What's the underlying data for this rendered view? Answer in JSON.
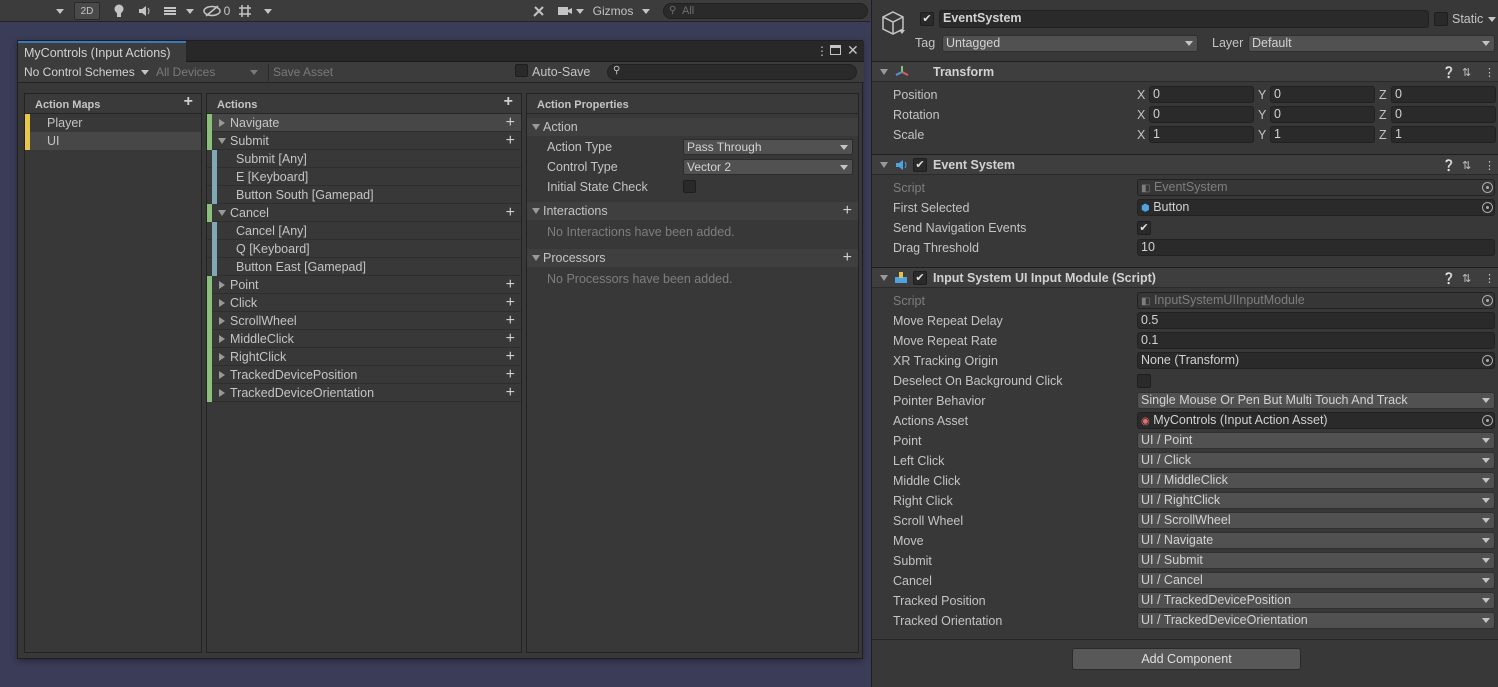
{
  "scene_toolbar": {
    "mode_2d": "2D",
    "hidden_count": "0",
    "gizmos_label": "Gizmos",
    "search_placeholder": "All"
  },
  "input_actions_window": {
    "tab_title": "MyControls (Input Actions)",
    "control_schemes": "No Control Schemes",
    "devices": "All Devices",
    "save_asset": "Save Asset",
    "auto_save": "Auto-Save",
    "action_maps_header": "Action Maps",
    "action_maps": [
      "Player",
      "UI"
    ],
    "actions_header": "Actions",
    "actions": [
      {
        "label": "Navigate",
        "kind": "action",
        "expanded": false
      },
      {
        "label": "Submit",
        "kind": "action",
        "expanded": true
      },
      {
        "label": "Submit [Any]",
        "kind": "binding"
      },
      {
        "label": "E [Keyboard]",
        "kind": "binding"
      },
      {
        "label": "Button South [Gamepad]",
        "kind": "binding"
      },
      {
        "label": "Cancel",
        "kind": "action",
        "expanded": true
      },
      {
        "label": "Cancel [Any]",
        "kind": "binding"
      },
      {
        "label": "Q [Keyboard]",
        "kind": "binding"
      },
      {
        "label": "Button East [Gamepad]",
        "kind": "binding"
      },
      {
        "label": "Point",
        "kind": "action",
        "expanded": false
      },
      {
        "label": "Click",
        "kind": "action",
        "expanded": false
      },
      {
        "label": "ScrollWheel",
        "kind": "action",
        "expanded": false
      },
      {
        "label": "MiddleClick",
        "kind": "action",
        "expanded": false
      },
      {
        "label": "RightClick",
        "kind": "action",
        "expanded": false
      },
      {
        "label": "TrackedDevicePosition",
        "kind": "action",
        "expanded": false
      },
      {
        "label": "TrackedDeviceOrientation",
        "kind": "action",
        "expanded": false
      }
    ],
    "properties_header": "Action Properties",
    "action_section": "Action",
    "action_type_label": "Action Type",
    "action_type_value": "Pass Through",
    "control_type_label": "Control Type",
    "control_type_value": "Vector 2",
    "initial_state_label": "Initial State Check",
    "interactions_section": "Interactions",
    "interactions_empty": "No Interactions have been added.",
    "processors_section": "Processors",
    "processors_empty": "No Processors have been added."
  },
  "inspector": {
    "object_name": "EventSystem",
    "static_label": "Static",
    "tag_label": "Tag",
    "tag_value": "Untagged",
    "layer_label": "Layer",
    "layer_value": "Default",
    "transform": {
      "title": "Transform",
      "position_label": "Position",
      "rotation_label": "Rotation",
      "scale_label": "Scale",
      "x": "X",
      "y": "Y",
      "z": "Z",
      "position": [
        "0",
        "0",
        "0"
      ],
      "rotation": [
        "0",
        "0",
        "0"
      ],
      "scale": [
        "1",
        "1",
        "1"
      ]
    },
    "event_system": {
      "title": "Event System",
      "script_label": "Script",
      "script_value": "EventSystem",
      "first_selected_label": "First Selected",
      "first_selected_value": "Button",
      "send_nav_label": "Send Navigation Events",
      "drag_threshold_label": "Drag Threshold",
      "drag_threshold_value": "10"
    },
    "input_module": {
      "title": "Input System UI Input Module (Script)",
      "script_label": "Script",
      "script_value": "InputSystemUIInputModule",
      "move_repeat_delay_label": "Move Repeat Delay",
      "move_repeat_delay_value": "0.5",
      "move_repeat_rate_label": "Move Repeat Rate",
      "move_repeat_rate_value": "0.1",
      "xr_origin_label": "XR Tracking Origin",
      "xr_origin_value": "None (Transform)",
      "deselect_label": "Deselect On Background Click",
      "pointer_behavior_label": "Pointer Behavior",
      "pointer_behavior_value": "Single Mouse Or Pen But Multi Touch And Track",
      "actions_asset_label": "Actions Asset",
      "actions_asset_value": "MyControls (Input Action Asset)",
      "bindings": [
        {
          "label": "Point",
          "value": "UI / Point"
        },
        {
          "label": "Left Click",
          "value": "UI / Click"
        },
        {
          "label": "Middle Click",
          "value": "UI / MiddleClick"
        },
        {
          "label": "Right Click",
          "value": "UI / RightClick"
        },
        {
          "label": "Scroll Wheel",
          "value": "UI / ScrollWheel"
        },
        {
          "label": "Move",
          "value": "UI / Navigate"
        },
        {
          "label": "Submit",
          "value": "UI / Submit"
        },
        {
          "label": "Cancel",
          "value": "UI / Cancel"
        },
        {
          "label": "Tracked Position",
          "value": "UI / TrackedDevicePosition"
        },
        {
          "label": "Tracked Orientation",
          "value": "UI / TrackedDeviceOrientation"
        }
      ]
    },
    "add_component": "Add Component"
  },
  "colors": {
    "map_marker": "#e8c84a",
    "action_marker": "#8bc07a",
    "binding_marker": "#7fa9b5",
    "selected_row": "#474747",
    "tab_accent": "#3a79bb"
  }
}
